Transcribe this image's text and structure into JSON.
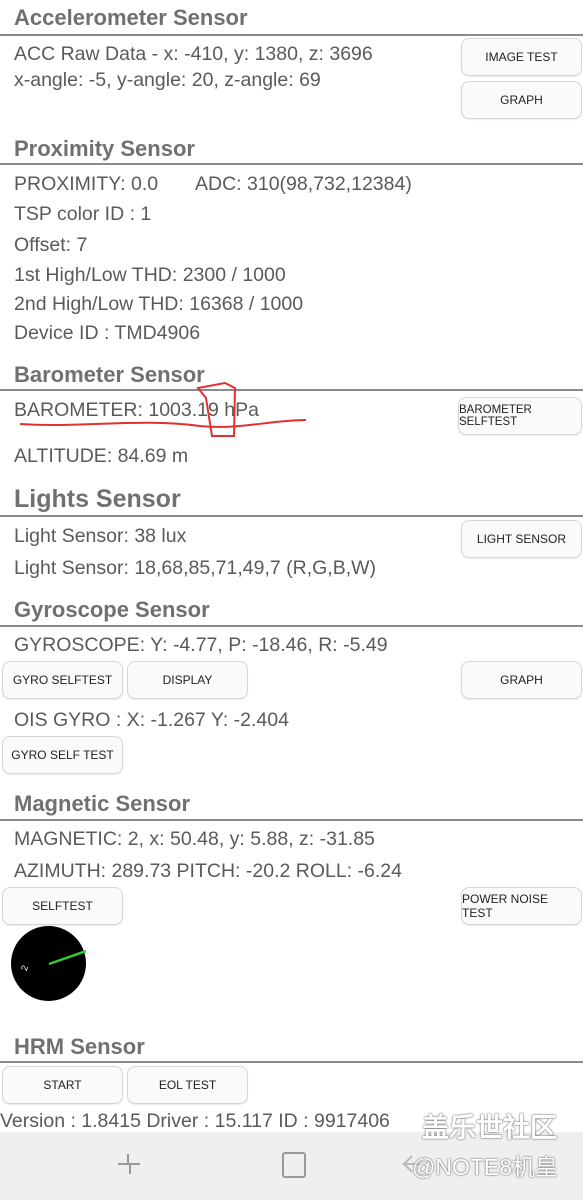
{
  "accelerometer": {
    "title": "Accelerometer Sensor",
    "raw": "ACC Raw Data - x: -410, y: 1380, z: 3696",
    "angle": "x-angle: -5, y-angle: 20, z-angle: 69",
    "image_test": "IMAGE TEST",
    "graph": "GRAPH"
  },
  "proximity": {
    "title": "Proximity Sensor",
    "value": "PROXIMITY: 0.0",
    "adc": "ADC: 310(98,732,12384)",
    "tsp": "TSP color ID : 1",
    "offset": "Offset: 7",
    "thd1": "1st High/Low THD: 2300 / 1000",
    "thd2": "2nd High/Low THD: 16368 / 1000",
    "device": "Device ID : TMD4906"
  },
  "barometer": {
    "title": "Barometer Sensor",
    "value": "BAROMETER: 1003.19 hPa",
    "altitude": "ALTITUDE: 84.69 m",
    "selftest": "BAROMETER SELFTEST"
  },
  "lights": {
    "title": "Lights Sensor",
    "lux": "Light Sensor: 38 lux",
    "rgbw": "Light Sensor: 18,68,85,71,49,7 (R,G,B,W)",
    "button": "LIGHT SENSOR"
  },
  "gyroscope": {
    "title": "Gyroscope Sensor",
    "value": "GYROSCOPE: Y: -4.77, P: -18.46, R: -5.49",
    "selftest": "GYRO SELFTEST",
    "display": "DISPLAY",
    "graph": "GRAPH",
    "ois": "OIS GYRO : X: -1.267 Y: -2.404",
    "self_test2": "GYRO SELF TEST"
  },
  "magnetic": {
    "title": "Magnetic Sensor",
    "value": "MAGNETIC: 2, x: 50.48, y: 5.88, z: -31.85",
    "orientation": "AZIMUTH: 289.73   PITCH: -20.2   ROLL: -6.24",
    "selftest": "SELFTEST",
    "power_noise": "POWER NOISE TEST",
    "compass_label": "2",
    "needle_color": "#33cc33"
  },
  "hrm": {
    "title": "HRM Sensor",
    "start": "START",
    "eol": "EOL TEST",
    "info": "Version : 1.8415   Driver : 15.117   ID : 9917406"
  },
  "watermark": {
    "line1": "盖乐世社区",
    "line2": "@NOTE8机皇"
  },
  "annotation_color": "#e03030"
}
